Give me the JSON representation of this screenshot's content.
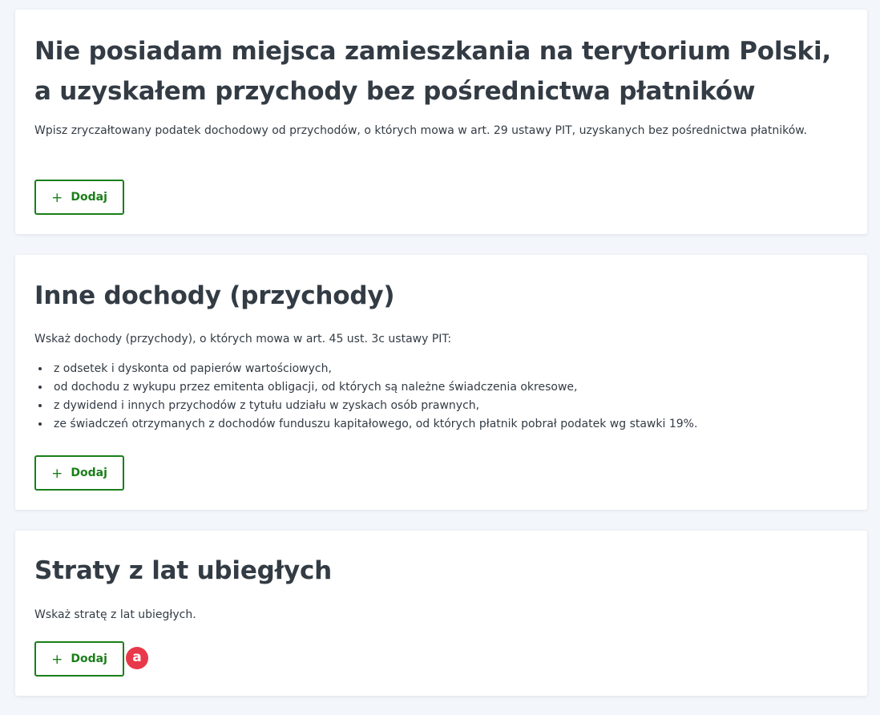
{
  "sections": [
    {
      "title": "Nie posiadam miejsca zamieszkania na terytorium Polski, a uzyskałem przychody bez pośrednictwa płatników",
      "description": "Wpisz zryczałtowany podatek dochodowy od przychodów, o których mowa w art. 29 ustawy PIT, uzyskanych bez pośrednictwa płatników.",
      "button_label": "Dodaj",
      "button_icon": "+"
    },
    {
      "title": "Inne dochody (przychody)",
      "description": "Wskaż dochody (przychody), o których mowa w art. 45 ust. 3c ustawy PIT:",
      "bullets": [
        "z odsetek i dyskonta od papierów wartościowych,",
        "od dochodu z wykupu przez emitenta obligacji, od których są należne świadczenia okresowe,",
        "z dywidend i innych przychodów z tytułu udziału w zyskach osób prawnych,",
        "ze świadczeń otrzymanych z dochodów funduszu kapitałowego, od których płatnik pobrał podatek wg stawki 19%."
      ],
      "button_label": "Dodaj",
      "button_icon": "+"
    },
    {
      "title": "Straty z lat ubiegłych",
      "description": "Wskaż stratę z lat ubiegłych.",
      "button_label": "Dodaj",
      "button_icon": "+"
    }
  ],
  "marker": {
    "label": "a"
  },
  "colors": {
    "page_background": "#f3f6fb",
    "card_background": "#ffffff",
    "text": "#333b44",
    "accent_green": "#1a7f1a",
    "marker_red": "#e8394a"
  }
}
